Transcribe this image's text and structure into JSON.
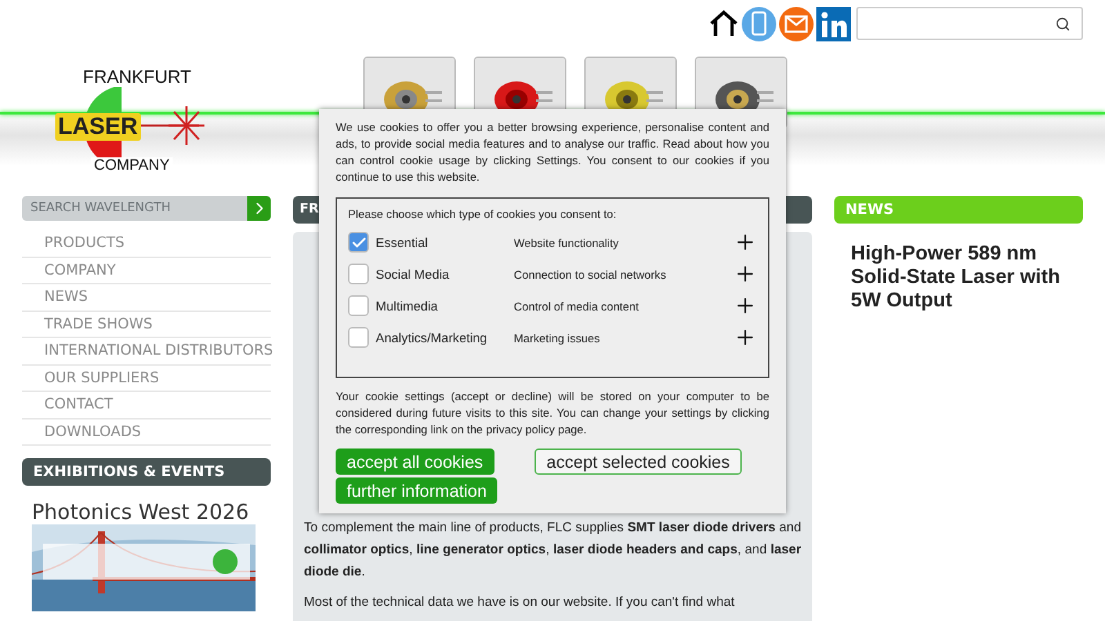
{
  "header": {
    "logo": {
      "top": "FRANKFURT",
      "middle": "LASER",
      "bottom": "COMPANY"
    }
  },
  "sidebar": {
    "search": {
      "placeholder": "SEARCH WAVELENGTH"
    },
    "nav": [
      {
        "label": "PRODUCTS"
      },
      {
        "label": "COMPANY"
      },
      {
        "label": "NEWS"
      },
      {
        "label": "TRADE SHOWS"
      },
      {
        "label": "INTERNATIONAL DISTRIBUTORS"
      },
      {
        "label": "OUR SUPPLIERS"
      },
      {
        "label": "CONTACT"
      },
      {
        "label": "DOWNLOADS"
      }
    ],
    "events": {
      "title": "EXHIBITIONS & EVENTS",
      "event": "Photonics West 2026"
    }
  },
  "main": {
    "heading": "FR",
    "paragraphs": [
      "To complement the main line of products, FLC supplies **SMT laser diode drivers** and **collimator optics**, **line generator optics**, **laser diode headers and caps**, and **laser diode die**.",
      "Most of the technical data we have is on our website. If you can't find what"
    ]
  },
  "news": {
    "title": "NEWS",
    "headline": "High-Power 589 nm Solid-State Laser with 5W Output"
  },
  "cookie_dialog": {
    "intro": "We use cookies to offer you a better browsing experience, personalise content and ads, to provide social media features and to analyse our traffic. Read about how you can control cookie usage by clicking Settings. You consent to our cookies if you continue to use this website.",
    "prompt": "Please choose which type of cookies you consent to:",
    "options": [
      {
        "label": "Essential",
        "description": "Website functionality",
        "checked": true
      },
      {
        "label": "Social Media",
        "description": "Connection to social networks",
        "checked": false
      },
      {
        "label": "Multimedia",
        "description": "Control of media content",
        "checked": false
      },
      {
        "label": "Analytics/Marketing",
        "description": "Marketing issues",
        "checked": false
      }
    ],
    "note": "Your cookie settings (accept or decline) will be stored on your computer to be considered during future visits to this site. You can change your settings by clicking the corresponding link on the privacy policy page.",
    "buttons": [
      {
        "label": "accept all cookies",
        "kind": "primary"
      },
      {
        "label": "accept selected cookies",
        "kind": "outline"
      },
      {
        "label": "further information",
        "kind": "primary"
      }
    ]
  }
}
